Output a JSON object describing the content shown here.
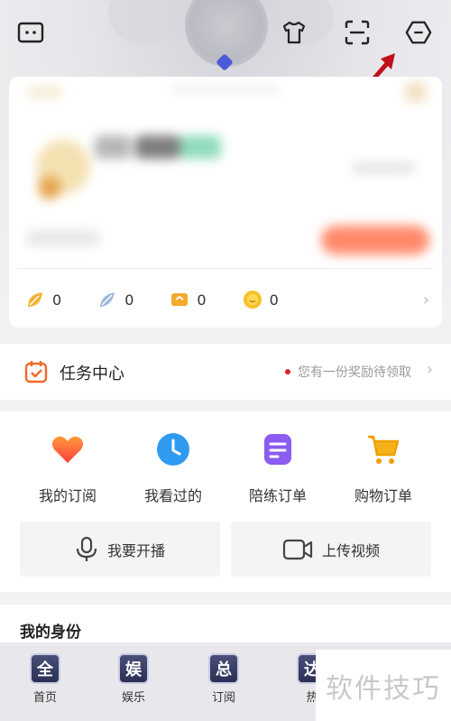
{
  "top_icons": [
    "chat-bubble-icon",
    "shirt-icon",
    "scan-icon",
    "menu-hex-icon"
  ],
  "stats": [
    {
      "icon": "leaf-coin-icon",
      "value": "0",
      "color": "#f2b233"
    },
    {
      "icon": "feather-icon",
      "value": "0",
      "color": "#9bb7dd"
    },
    {
      "icon": "ticket-icon",
      "value": "0",
      "color": "#f4a92a"
    },
    {
      "icon": "smile-coin-icon",
      "value": "0",
      "color": "#f6c22c"
    }
  ],
  "task_center": {
    "title": "任务中心",
    "hint": "您有一份奖励待领取"
  },
  "shortcuts": [
    {
      "label": "我的订阅",
      "icon": "heart-icon"
    },
    {
      "label": "我看过的",
      "icon": "clock-icon"
    },
    {
      "label": "陪练订单",
      "icon": "document-icon"
    },
    {
      "label": "购物订单",
      "icon": "cart-icon"
    }
  ],
  "actions": [
    {
      "label": "我要开播",
      "icon": "microphone-icon"
    },
    {
      "label": "上传视频",
      "icon": "video-camera-icon"
    }
  ],
  "identity": {
    "title": "我的身份"
  },
  "tabs": [
    {
      "badge": "全",
      "label": "首页"
    },
    {
      "badge": "娱",
      "label": "娱乐"
    },
    {
      "badge": "总",
      "label": "订阅"
    },
    {
      "badge": "达",
      "label": "热"
    }
  ],
  "watermark": "软件技巧",
  "colors": {
    "accent": "#f0682a",
    "arrow": "#c0101a",
    "background": "#f2f2f4"
  }
}
